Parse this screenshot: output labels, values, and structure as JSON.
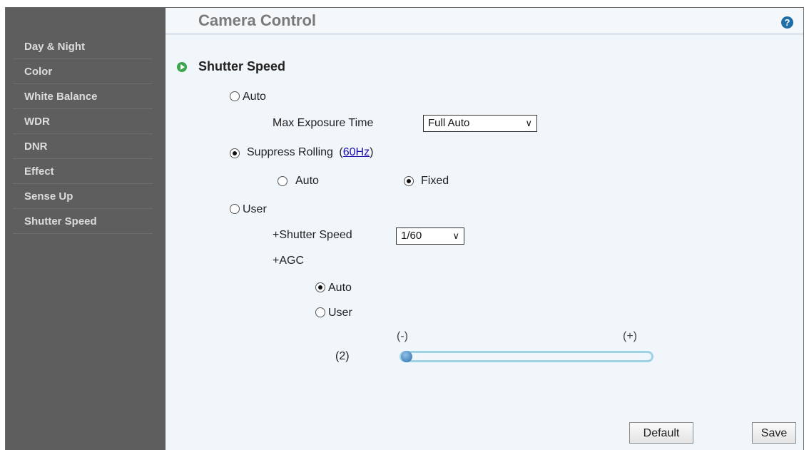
{
  "sidebar": {
    "items": [
      {
        "label": "Day & Night"
      },
      {
        "label": "Color"
      },
      {
        "label": "White Balance"
      },
      {
        "label": "WDR"
      },
      {
        "label": "DNR"
      },
      {
        "label": "Effect"
      },
      {
        "label": "Sense Up"
      },
      {
        "label": "Shutter Speed"
      }
    ]
  },
  "header": {
    "title": "Camera Control",
    "help_icon": "?"
  },
  "section": {
    "title": "Shutter Speed"
  },
  "options": {
    "auto_label": "Auto",
    "max_exposure_label": "Max Exposure Time",
    "max_exposure_value": "Full Auto",
    "suppress_label": "Suppress Rolling",
    "suppress_open": "(",
    "suppress_link": "60Hz",
    "suppress_close": ")",
    "suppress_auto_label": "Auto",
    "suppress_fixed_label": "Fixed",
    "user_label": "User",
    "shutter_speed_label": "+Shutter Speed",
    "shutter_speed_value": "1/60",
    "agc_label": "+AGC",
    "agc_auto_label": "Auto",
    "agc_user_label": "User",
    "slider_min_label": "(-)",
    "slider_max_label": "(+)",
    "slider_value_label": "(2)",
    "slider_position": 0.0
  },
  "buttons": {
    "default_label": "Default",
    "save_label": "Save"
  },
  "selected": {
    "mode": "suppress_rolling",
    "suppress_mode": "fixed",
    "agc_mode": "auto"
  }
}
